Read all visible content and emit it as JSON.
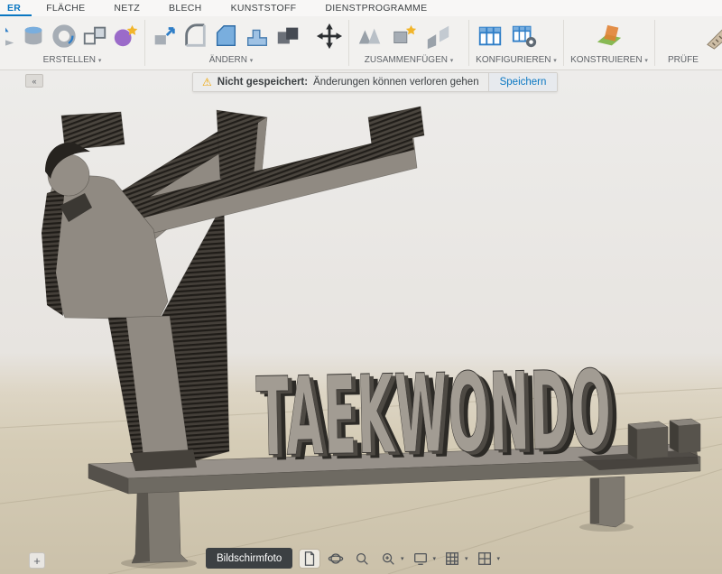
{
  "colors": {
    "accent_blue": "#0a77c2",
    "warning_yellow": "#f0a500",
    "tooltip_bg": "#3c4043",
    "model_gray": "#8e8880",
    "model_dark_side": "#2c2a26",
    "ground_tan": "#d5ccb7",
    "background_gray": "#e9e7e4"
  },
  "menubar": {
    "tabs": [
      {
        "label": "ER",
        "active": true
      },
      {
        "label": "FLÄCHE",
        "active": false
      },
      {
        "label": "NETZ",
        "active": false
      },
      {
        "label": "BLECH",
        "active": false
      },
      {
        "label": "KUNSTSTOFF",
        "active": false
      },
      {
        "label": "DIENSTPROGRAMME",
        "active": false
      }
    ]
  },
  "toolbar": {
    "groups": [
      {
        "label": "ERSTELLEN",
        "caret": "▾"
      },
      {
        "label": "ÄNDERN",
        "caret": "▾"
      },
      {
        "label": "ZUSAMMENFÜGEN",
        "caret": "▾"
      },
      {
        "label": "KONFIGURIEREN",
        "caret": "▾"
      },
      {
        "label": "KONSTRUIEREN",
        "caret": "▾"
      },
      {
        "label": "PRÜFE",
        "caret": ""
      }
    ],
    "icon_names": [
      "extrude",
      "cylinder-primitive",
      "revolve",
      "rectangular-pattern",
      "form-sphere",
      "press-pull",
      "fillet",
      "chamfer",
      "shell",
      "combine",
      "move-copy",
      "assembly",
      "new-component",
      "joint",
      "configuration-table",
      "configuration-insert",
      "construction-plane",
      "measure"
    ]
  },
  "warning_bar": {
    "icon": "⚠",
    "title": "Nicht gespeichert:",
    "message": "Änderungen können verloren gehen",
    "action_label": "Speichern"
  },
  "viewport": {
    "model_text": "TAEKWONDO",
    "browser_collapse_glyph": "«",
    "add_button_glyph": "+"
  },
  "bottom_bar": {
    "tooltip": "Bildschirmfoto",
    "caret": "▾",
    "icon_names": [
      "screenshot-page",
      "orbit",
      "fit-view",
      "zoom-window",
      "display-settings",
      "grid-settings",
      "viewports"
    ]
  }
}
